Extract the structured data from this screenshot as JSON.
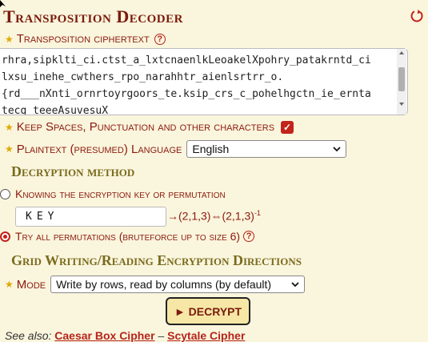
{
  "title": "Transposition Decoder",
  "icons": {
    "reset": "reset-icon",
    "help": "help-icon",
    "star": "star-icon",
    "chevron": "chevron-down-icon"
  },
  "ciphertext": {
    "label": "Transposition ciphertext",
    "help": "?",
    "lines": [
      "rhra,sipklti_ci.ctst_a_lxtcnaenlkLeoakelXpohry_patakrntd_ci",
      "lxsu_inehe_cwthers_rpo_narahhtr_aienlsrtrr_o.",
      "{rd___nXnti_ornrtoyrgoors_te.ksip_crs_c_pohelhgctn_ie_ernta",
      "tecg_teeeAsuvesuX"
    ]
  },
  "keep_spaces": {
    "label": "Keep Spaces, Punctuation and other characters",
    "checked": true,
    "mark": "✓"
  },
  "language": {
    "label": "Plaintext (presumed) Language",
    "value": "English"
  },
  "decryption_method": {
    "heading": "Decryption method",
    "option_key": "Knowing the encryption key or permutation",
    "key_value": "KEY",
    "permutation_text": "→(2,1,3)⇔(2,1,3)",
    "permutation_sup": "-1",
    "option_bruteforce": "Try all permutations (bruteforce up to size 6)",
    "selected": "bruteforce"
  },
  "grid_directions": {
    "heading": "Grid Writing/Reading Encryption Directions",
    "mode_label": "Mode",
    "mode_value": "Write by rows, read by columns (by default)"
  },
  "decrypt_button": "► DECRYPT",
  "see_also": {
    "prefix": "See also:",
    "links": [
      "Caesar Box Cipher",
      "Scytale Cipher"
    ],
    "separator": "–"
  },
  "colors": {
    "accent": "#c2231a",
    "heading": "#7a6b1e",
    "text": "#8b1a0e",
    "background": "#faf5dd"
  }
}
